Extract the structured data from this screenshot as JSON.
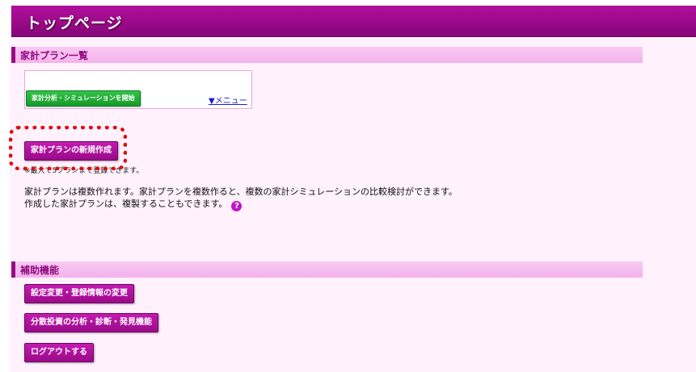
{
  "header": {
    "title": "トップページ"
  },
  "plan_section": {
    "title": "家計プラン一覧",
    "start_button": "家計分析・シミュレーションを開始",
    "menu_link": "▼メニュー",
    "new_plan_button": "家計プランの新規作成",
    "limit_note": "※最大で5プランまで登録できます。",
    "description_line1": "家計プランは複数作れます。家計プランを複数作ると、複数の家計シミュレーションの比較検討ができます。",
    "description_line2": "作成した家計プランは、複製することもできます。",
    "help_icon": "?"
  },
  "aux_section": {
    "title": "補助機能",
    "buttons": [
      "設定変更・登録情報の変更",
      "分散投資の分析・診断・発見機能",
      "ログアウトする"
    ]
  },
  "colors": {
    "header": "#9b0a88",
    "section_bar": "#f6bdee",
    "button": "#b0139f",
    "green_button": "#22ad38",
    "highlight": "#e50b0b"
  }
}
